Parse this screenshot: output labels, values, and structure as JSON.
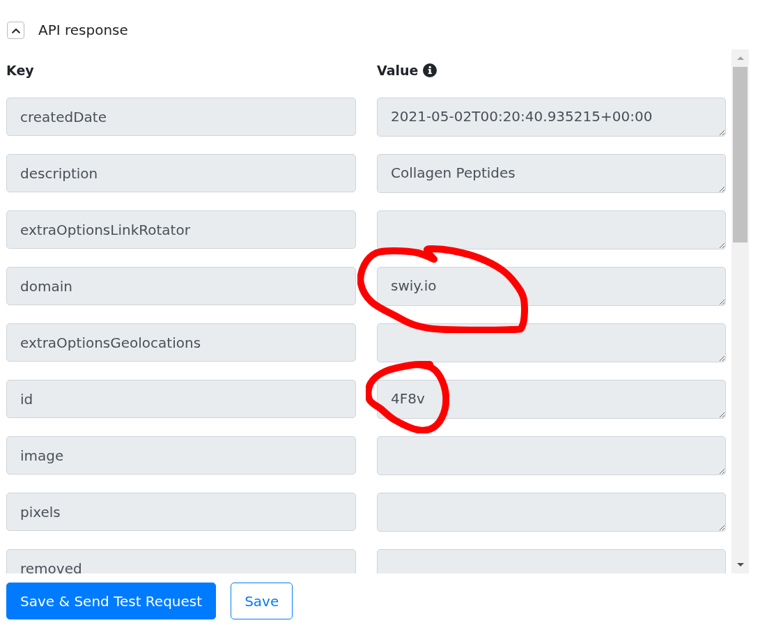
{
  "section": {
    "title": "API response",
    "expanded": true
  },
  "columns": [
    {
      "label": "Key",
      "info": false
    },
    {
      "label": "Value",
      "info": true
    }
  ],
  "rows": [
    {
      "key": "createdDate",
      "value": "2021-05-02T00:20:40.935215+00:00",
      "circled": false
    },
    {
      "key": "description",
      "value": "Collagen Peptides",
      "circled": false
    },
    {
      "key": "extraOptionsLinkRotator",
      "circled": false
    },
    {
      "key": "domain",
      "value": "swiy.io",
      "circled": true
    },
    {
      "key": "extraOptionsGeolocations",
      "circled": false
    },
    {
      "key": "id",
      "value": "4F8v",
      "circled": true
    },
    {
      "key": "image",
      "circled": false
    },
    {
      "key": "pixels",
      "circled": false
    },
    {
      "key": "removed",
      "circled": false
    }
  ],
  "buttons": [
    {
      "label": "Save & Send Test Request",
      "kind": "primary"
    },
    {
      "label": "Save",
      "kind": "outline"
    }
  ]
}
